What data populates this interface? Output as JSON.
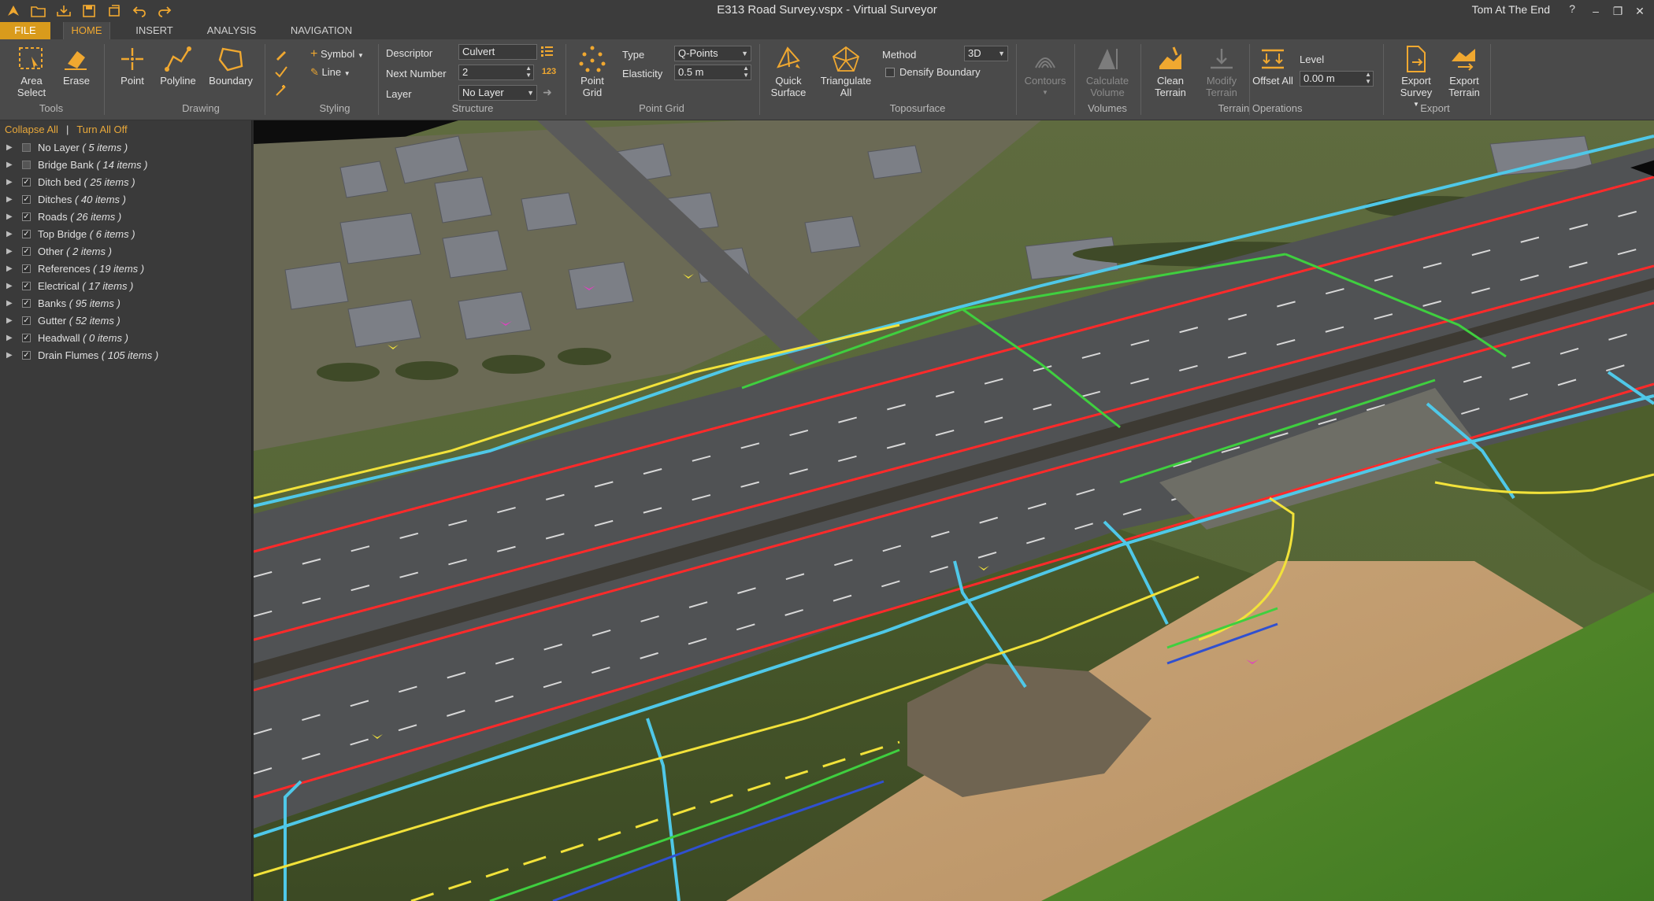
{
  "window": {
    "title": "E313 Road Survey.vspx  -  Virtual Surveyor",
    "user": "Tom At The End",
    "help": "?"
  },
  "tabs": [
    "FILE",
    "HOME",
    "INSERT",
    "ANALYSIS",
    "NAVIGATION"
  ],
  "ribbon": {
    "tools": {
      "area_select": "Area Select",
      "erase": "Erase",
      "group": "Tools"
    },
    "drawing": {
      "point": "Point",
      "polyline": "Polyline",
      "boundary": "Boundary",
      "group": "Drawing"
    },
    "styling": {
      "symbol": "Symbol",
      "line": "Line",
      "group": "Styling"
    },
    "structure": {
      "descriptor_label": "Descriptor",
      "descriptor_value": "Culvert",
      "next_number_label": "Next Number",
      "next_number_value": "2",
      "layer_label": "Layer",
      "layer_value": "No Layer",
      "group": "Structure"
    },
    "point_grid": {
      "button": "Point Grid",
      "type_label": "Type",
      "type_value": "Q-Points",
      "elasticity_label": "Elasticity",
      "elasticity_value": "0.5 m",
      "group": "Point Grid"
    },
    "toposurface": {
      "quick_surface": "Quick Surface",
      "triangulate_all": "Triangulate All",
      "method_label": "Method",
      "method_value": "3D",
      "densify_boundary": "Densify Boundary",
      "group": "Toposurface"
    },
    "contours": {
      "button": "Contours"
    },
    "volumes": {
      "calculate_volume": "Calculate Volume",
      "group": "Volumes"
    },
    "terrain_ops": {
      "clean_terrain": "Clean Terrain",
      "modify_terrain": "Modify Terrain",
      "offset_all": "Offset All",
      "level_label": "Level",
      "level_value": "0.00 m",
      "group": "Terrain Operations"
    },
    "export": {
      "export_survey": "Export Survey",
      "export_terrain": "Export Terrain",
      "group": "Export"
    }
  },
  "sidebar": {
    "collapse_all": "Collapse All",
    "separator": "|",
    "turn_all_off": "Turn All Off",
    "layers": [
      {
        "name": "No Layer",
        "count": "( 5 items )",
        "checked": false
      },
      {
        "name": "Bridge Bank",
        "count": "( 14 items )",
        "checked": false
      },
      {
        "name": "Ditch bed",
        "count": "( 25 items )",
        "checked": true
      },
      {
        "name": "Ditches",
        "count": "( 40 items )",
        "checked": true
      },
      {
        "name": "Roads",
        "count": "( 26 items )",
        "checked": true
      },
      {
        "name": "Top Bridge",
        "count": "( 6 items )",
        "checked": true
      },
      {
        "name": "Other",
        "count": "( 2 items )",
        "checked": true
      },
      {
        "name": "References",
        "count": "( 19 items )",
        "checked": true
      },
      {
        "name": "Electrical",
        "count": "( 17 items )",
        "checked": true
      },
      {
        "name": "Banks",
        "count": "( 95 items )",
        "checked": true
      },
      {
        "name": "Gutter",
        "count": "( 52 items )",
        "checked": true
      },
      {
        "name": "Headwall",
        "count": "( 0 items )",
        "checked": true
      },
      {
        "name": "Drain Flumes",
        "count": "( 105 items )",
        "checked": true
      }
    ]
  },
  "colors": {
    "accent": "#f0a830",
    "file_tab": "#d99b1c",
    "line_red": "#ff2a2a",
    "line_cyan": "#4fc8e8",
    "line_yellow": "#f2e23a",
    "line_green": "#3fcf3f",
    "line_blue": "#3050d0",
    "marker_magenta": "#e040c0"
  }
}
